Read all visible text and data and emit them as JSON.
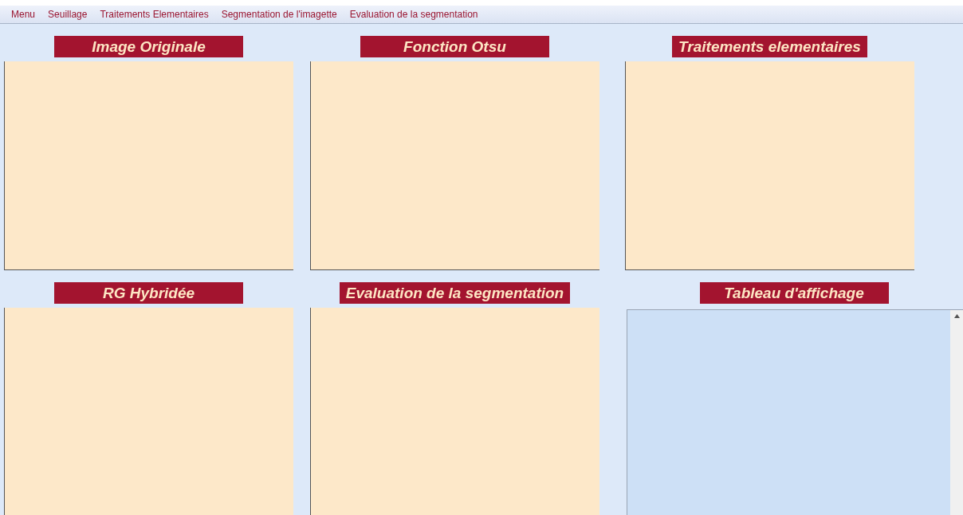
{
  "menu_bar": [
    {
      "label": "Menu"
    },
    {
      "label": "Seuillage"
    },
    {
      "label": "Traitements Elementaires"
    },
    {
      "label": "Segmentation de l'imagette"
    },
    {
      "label": "Evaluation de la segmentation"
    }
  ],
  "rows": [
    [
      {
        "title": "Image Originale",
        "kind": "image"
      },
      {
        "title": "Fonction Otsu",
        "kind": "image"
      },
      {
        "title": "Traitements elementaires",
        "kind": "image"
      }
    ],
    [
      {
        "title": "RG Hybridée",
        "kind": "image"
      },
      {
        "title": "Evaluation de la segmentation",
        "kind": "image"
      },
      {
        "title": "Tableau d'affichage",
        "kind": "text"
      }
    ]
  ]
}
